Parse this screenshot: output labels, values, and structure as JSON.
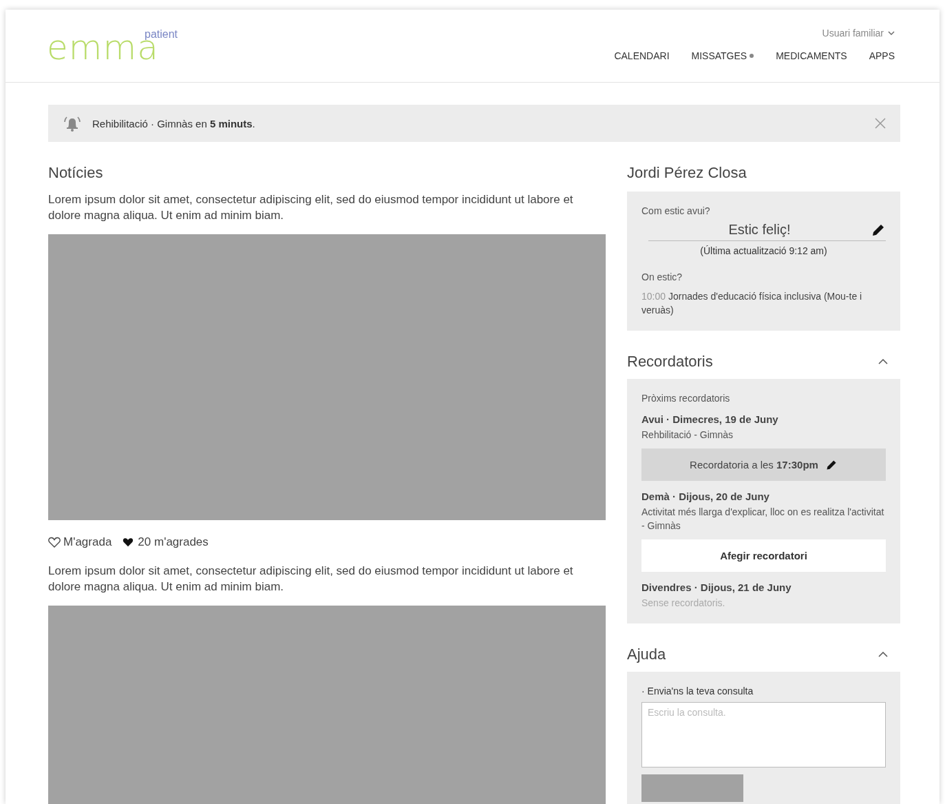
{
  "header": {
    "logo": "emma",
    "logo_sub": "patient",
    "user_menu": "Usuari familiar",
    "nav": [
      {
        "label": "CALENDARI",
        "unread": false
      },
      {
        "label": "MISSATGES",
        "unread": true
      },
      {
        "label": "MEDICAMENTS",
        "unread": false
      },
      {
        "label": "APPS",
        "unread": false
      }
    ]
  },
  "alert": {
    "text": "Rehibilitació · Gimnàs en **5 minuts**."
  },
  "news": {
    "title": "Notícies",
    "posts": [
      {
        "text": "Lorem ipsum dolor sit amet, consectetur adipiscing elit, sed do eiusmod tempor incididunt ut labore et dolore magna aliqua. Ut enim ad minim biam.",
        "like_label": "M'agrada",
        "liked": false,
        "likes": "20 m'agrades"
      },
      {
        "text": "Lorem ipsum dolor sit amet, consectetur adipiscing elit, sed do eiusmod tempor incididunt ut labore et dolore magna aliqua. Ut enim ad minim biam."
      }
    ]
  },
  "profile": {
    "name": "Jordi Pérez Closa",
    "mood_label": "Com estic avui?",
    "mood": "Estic feliç!",
    "updated": "(Última actualització 9:12 am)",
    "location_label": "On estic?",
    "location_time": "10:00",
    "location": "Jornades d'educació física inclusiva (Mou-te i veruàs)"
  },
  "reminders": {
    "title": "Recordatoris",
    "expanded": true,
    "subtitle": "Pròxims recordatoris",
    "days": [
      {
        "heading": "Avui · Dimecres, 19 de Juny",
        "detail": "Rehbilitació - Gimnàs",
        "muted": false,
        "action": {
          "kind": "reminder",
          "text": "Recordatoria a les **17:30pm**"
        }
      },
      {
        "heading": "Demà · Dijous, 20 de Juny",
        "detail": "Activitat més llarga d'explicar, lloc on es realitza l'activitat - Gimnàs",
        "muted": false,
        "action": {
          "kind": "add",
          "text": "Afegir recordatori"
        }
      },
      {
        "heading": "Divendres · Dijous, 21 de Juny",
        "detail": "Sense recordatoris.",
        "muted": true
      }
    ]
  },
  "help": {
    "title": "Ajuda",
    "expanded": true,
    "label": "· Envia'ns la teva consulta",
    "placeholder": "Escriu la consulta."
  }
}
